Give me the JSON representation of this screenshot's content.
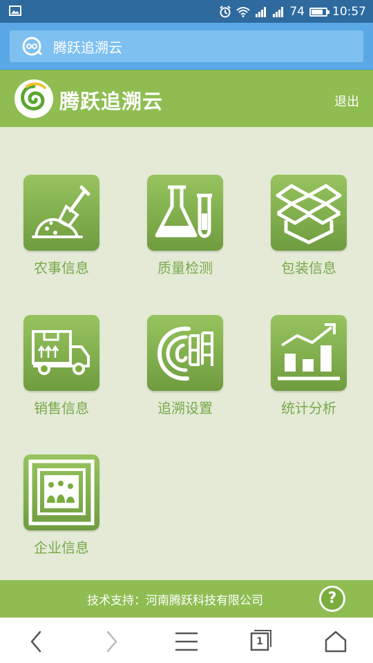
{
  "status_bar": {
    "battery": "74",
    "time": "10:57",
    "battery_level": 0.74
  },
  "browser": {
    "address_text": "腾跃追溯云"
  },
  "header": {
    "brand": "腾跃追溯云",
    "logout": "退出"
  },
  "tiles": [
    {
      "label": "农事信息",
      "icon": "shovel-icon"
    },
    {
      "label": "质量检测",
      "icon": "flask-icon"
    },
    {
      "label": "包装信息",
      "icon": "box-icon"
    },
    {
      "label": "销售信息",
      "icon": "truck-icon"
    },
    {
      "label": "追溯设置",
      "icon": "trace-logo-icon"
    },
    {
      "label": "统计分析",
      "icon": "chart-icon"
    },
    {
      "label": "企业信息",
      "icon": "enterprise-icon"
    }
  ],
  "footer": {
    "support": "技术支持：河南腾跃科技有限公司",
    "help": "?"
  },
  "nav": {
    "tab_count": "1"
  },
  "colors": {
    "green": "#8fbd52",
    "tile_green": "#7aad3e",
    "label_green": "#78a94a",
    "background": "#e4ead6",
    "status_blue": "#2e6a9e",
    "address_blue": "#5aa9e6"
  }
}
